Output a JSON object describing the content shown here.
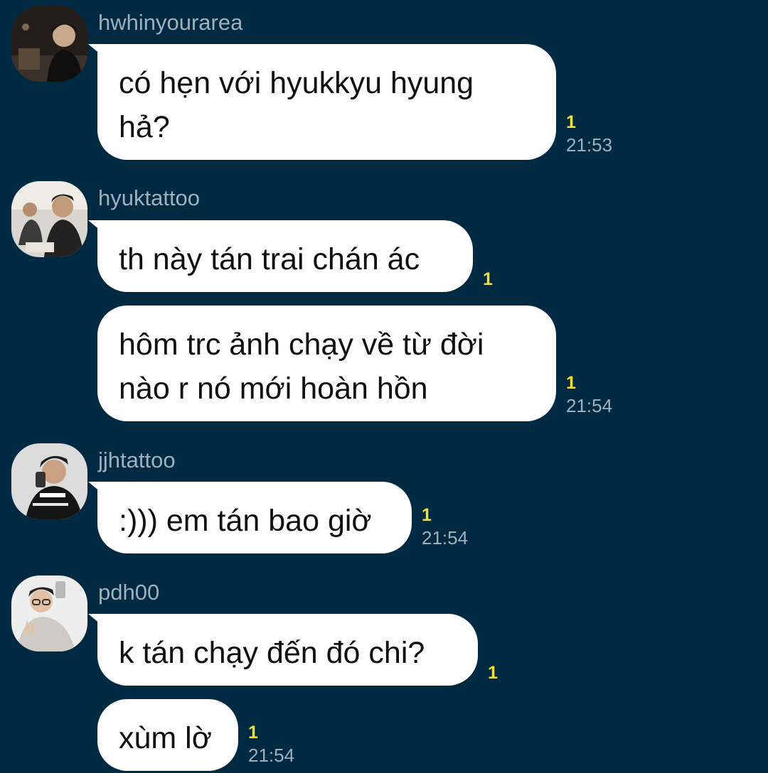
{
  "messages": [
    {
      "sender": "hwhinyourarea",
      "bubbles": [
        {
          "text_lines": [
            "có hẹn với hyukkyu hyung",
            "hả?"
          ],
          "read_count": "1",
          "time": "21:53"
        }
      ]
    },
    {
      "sender": "hyuktattoo",
      "bubbles": [
        {
          "text_lines": [
            "th này tán trai chán ác"
          ],
          "read_count": "1",
          "time": ""
        },
        {
          "text_lines": [
            "hôm trc ảnh chạy về từ đời",
            "nào r nó mới hoàn hồn"
          ],
          "read_count": "1",
          "time": "21:54"
        }
      ]
    },
    {
      "sender": "jjhtattoo",
      "bubbles": [
        {
          "text_lines": [
            ":))) em tán bao giờ"
          ],
          "read_count": "1",
          "time": "21:54"
        }
      ]
    },
    {
      "sender": "pdh00",
      "bubbles": [
        {
          "text_lines": [
            "k tán chạy đến đó chi?"
          ],
          "read_count": "1",
          "time": ""
        },
        {
          "text_lines": [
            "xùm lờ"
          ],
          "read_count": "1",
          "time": "21:54"
        }
      ]
    }
  ],
  "avatars": [
    "avatar-photo-icon",
    "avatar-photo-icon",
    "avatar-photo-icon",
    "avatar-photo-icon"
  ],
  "colors": {
    "background": "#002a42",
    "bubble": "#ffffff",
    "read_count": "#f3df3a",
    "secondary_text": "#9fb0bd"
  }
}
